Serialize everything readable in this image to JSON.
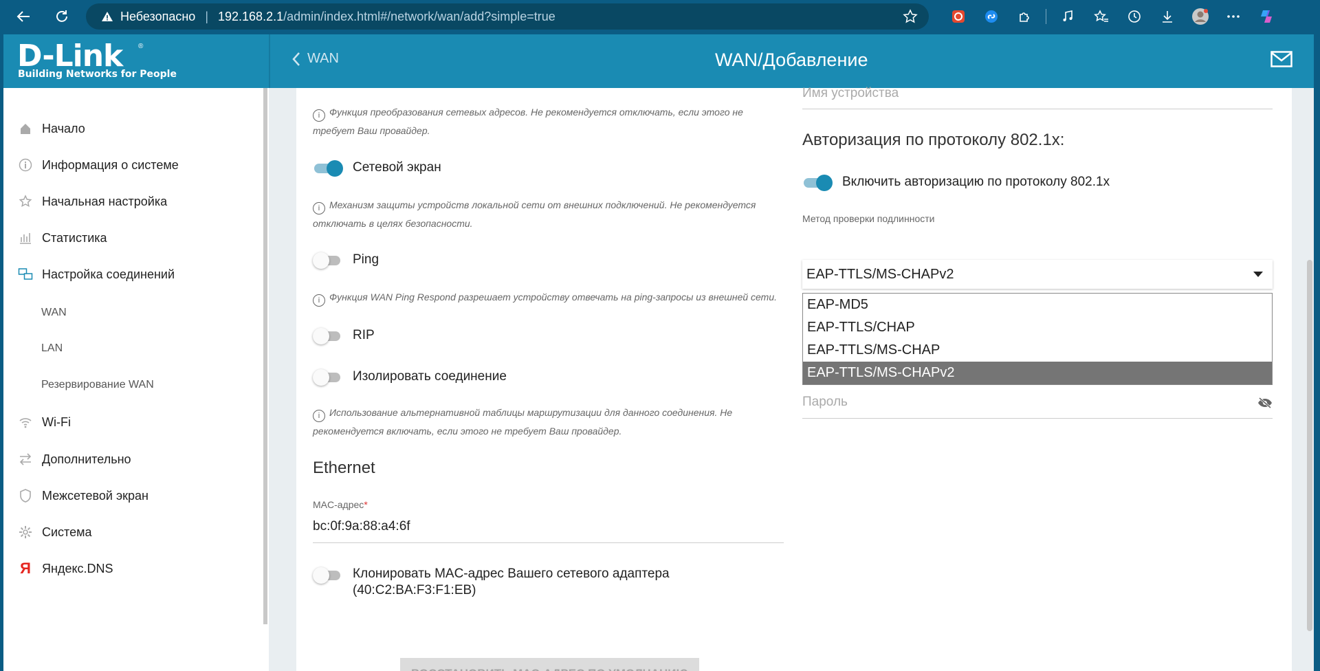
{
  "browser": {
    "insecure_label": "Небезопасно",
    "url_host": "192.168.2.1",
    "url_path": "/admin/index.html#/network/wan/add?simple=true"
  },
  "header": {
    "logo_main": "D-Link",
    "logo_sub": "Building Networks for People",
    "back_label": "WAN",
    "title": "WAN/Добавление"
  },
  "sidebar": {
    "items": [
      {
        "label": "Начало",
        "icon": "home-icon"
      },
      {
        "label": "Информация о системе",
        "icon": "info-icon"
      },
      {
        "label": "Начальная настройка",
        "icon": "star-icon"
      },
      {
        "label": "Статистика",
        "icon": "stats-icon"
      },
      {
        "label": "Настройка соединений",
        "icon": "connections-icon"
      },
      {
        "label": "Wi-Fi",
        "icon": "wifi-icon"
      },
      {
        "label": "Дополнительно",
        "icon": "arrows-icon"
      },
      {
        "label": "Межсетевой экран",
        "icon": "shield-icon"
      },
      {
        "label": "Система",
        "icon": "gear-icon"
      },
      {
        "label": "Яндекс.DNS",
        "icon": "yandex-icon"
      }
    ],
    "subitems": [
      "WAN",
      "LAN",
      "Резервирование WAN"
    ]
  },
  "left": {
    "nat_hint_line1": "Функция преобразования сетевых адресов. Не рекомендуется отключать, если этого не",
    "nat_hint_line2": "требует Ваш провайдер.",
    "firewall_label": "Сетевой экран",
    "firewall_on": true,
    "firewall_hint_line1": "Механизм защиты устройств локальной сети от внешних подключений. Не рекомендуется",
    "firewall_hint_line2": "отключать в целях безопасности.",
    "ping_label": "Ping",
    "ping_on": false,
    "ping_hint": "Функция WAN Ping Respond разрешает устройству отвечать на ping-запросы из внешней сети.",
    "rip_label": "RIP",
    "rip_on": false,
    "isolate_label": "Изолировать соединение",
    "isolate_on": false,
    "isolate_hint_line1": "Использование альтернативной таблицы маршрутизации для данного соединения. Не",
    "isolate_hint_line2": "рекомендуется включать, если этого не требует Ваш провайдер.",
    "ethernet_title": "Ethernet",
    "mac_label": "MAC-адрес",
    "mac_required_mark": "*",
    "mac_value": "bc:0f:9a:88:a4:6f",
    "clone_label_line1": "Клонировать MAC-адрес Вашего сетевого адаптера",
    "clone_label_line2": "(40:C2:BA:F3:F1:EB)",
    "clone_on": false,
    "restore_button": "ВОССТАНОВИТЬ MAC-АДРЕС ПО УМОЛЧАНИЮ"
  },
  "right": {
    "device_name_placeholder": "Имя устройства",
    "auth_title": "Авторизация по протоколу 802.1x:",
    "auth_toggle_label": "Включить авторизацию по протоколу 802.1x",
    "auth_on": true,
    "method_label": "Метод проверки подлинности",
    "method_value": "EAP-TTLS/MS-CHAPv2",
    "method_options": [
      "EAP-MD5",
      "EAP-TTLS/CHAP",
      "EAP-TTLS/MS-CHAP",
      "EAP-TTLS/MS-CHAPv2"
    ],
    "method_selected_index": 3,
    "password_placeholder": "Пароль"
  },
  "colors": {
    "brand": "#1a8bb3",
    "browser": "#0b5c84",
    "selected_option": "#757575"
  }
}
